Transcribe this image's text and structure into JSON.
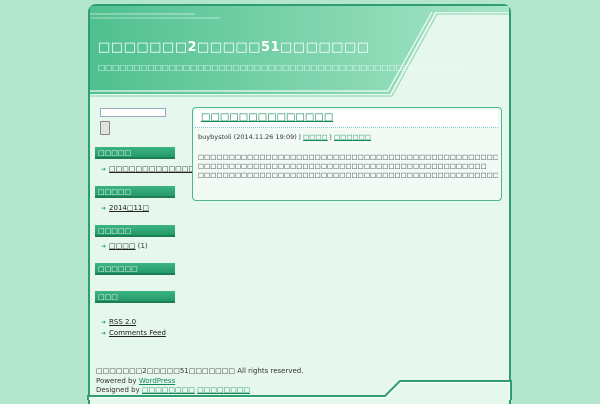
{
  "header": {
    "title": "□□□□□□□2□□□□□51□□□□□□□",
    "description": "□□□□□□□□□□□□□□□□□□□□□□□□□□□□□□□□□□□□□□□□□□□□□□□□□□□□"
  },
  "sidebar": {
    "search": {
      "placeholder": ""
    },
    "widgets": [
      {
        "title": "□□□□□",
        "items": [
          {
            "label": "□□□□□□□□□□□□□"
          }
        ]
      },
      {
        "title": "□□□□□",
        "items": [
          {
            "label": "2014□11□"
          }
        ]
      },
      {
        "title": "□□□□□",
        "items": [
          {
            "label": "□□□□",
            "count": "(1)"
          }
        ]
      },
      {
        "title": "□□□□□□",
        "items": []
      },
      {
        "title": "□□□",
        "items": [
          {
            "label": "RSS 2.0"
          },
          {
            "label": "Comments Feed"
          }
        ]
      }
    ]
  },
  "post": {
    "title": "□□□□□□□□□□□□□□",
    "author": "buybystoli",
    "date": "(2014.11.26 19:09)",
    "separator": "|",
    "category": "□□□□",
    "comments": "□□□□□□",
    "body_lines": [
      "□□□□□□□□□□□□□□□□□□□□□□□□□□□□□□□□□□□□□□□□□□□□□□□□□□□□□□□□□□□□□□□□□□□□□□□□",
      "□□□□□□□□□□□□□□□□□□□□□□□□□□□□□□□□□□□□□□□□□□□□□□□",
      "□□□□□□□□□□□□□□□□□□□□□□□□□□□□□□□□□□□□□□□□□□□□□□□□□□□□□□□□□□□□□□□□□□□□□"
    ]
  },
  "footer": {
    "copyright": "□□□□□□□2□□□□□51□□□□□□□ All rights reserved.",
    "powered_prefix": "Powered by",
    "powered_link": "WordPress",
    "designed_prefix": "Designed by",
    "designer_1": "□□□□□□□□",
    "designer_2": "□□□□□□□□"
  },
  "colors": {
    "accent": "#2e9e6e",
    "page_bg": "#b3e6cc",
    "content_bg": "#e6f7ee"
  }
}
